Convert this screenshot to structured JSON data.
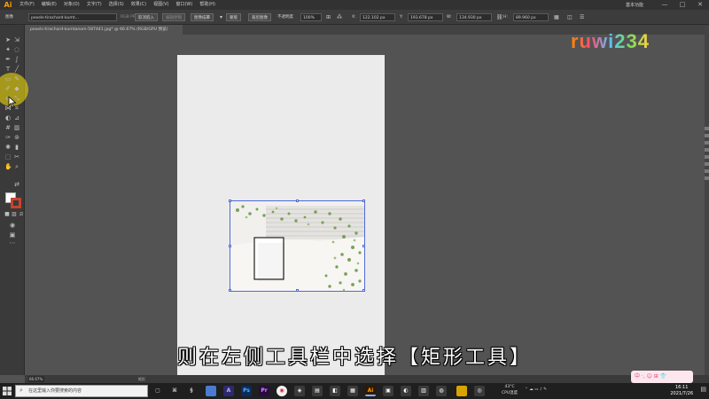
{
  "app": {
    "logo": "Ai"
  },
  "menu": {
    "items": [
      "文件(F)",
      "编辑(E)",
      "对象(O)",
      "文字(T)",
      "选择(S)",
      "效果(C)",
      "视图(V)",
      "窗口(W)",
      "帮助(H)"
    ],
    "workspace": "基本功能",
    "window_buttons": [
      "—",
      "□",
      "✕"
    ]
  },
  "control_bar": {
    "object_type": "图像",
    "file_name": "pexels-tirachard-kumt…",
    "color_info": "RGB PPI: 1120",
    "unembed": "取消嵌入",
    "edit_original": "编辑原稿",
    "image_trace": "图像描摹",
    "mask": "蒙版",
    "crop_image": "裁剪图像",
    "opacity_label": "不透明度",
    "opacity_value": "100%",
    "x_label": "X:",
    "x_value": "122.102 px",
    "y_label": "Y:",
    "y_value": "193.678 px",
    "w_label": "W:",
    "w_value": "134.930 px",
    "h_label": "H:",
    "h_value": "89.960 px"
  },
  "document_tab": {
    "title": "pexels-tirachard-kumtanom-587441.jpg* @ 66.67% (RGB/GPU 预览)"
  },
  "toolbar": {
    "icons": [
      "selection-tool",
      "direct-selection-tool",
      "magic-wand-tool",
      "pen-tool",
      "type-tool",
      "line-segment-tool",
      "rectangle-tool",
      "paintbrush-tool",
      "eraser-tool",
      "rotate-tool",
      "scale-tool",
      "width-tool",
      "free-transform-tool",
      "shape-builder-tool",
      "perspective-grid-tool",
      "mesh-tool",
      "gradient-tool",
      "eyedropper-tool",
      "blend-tool",
      "symbol-sprayer-tool",
      "column-graph-tool",
      "artboard-tool",
      "slice-tool",
      "hand-tool",
      "zoom-tool"
    ]
  },
  "canvas": {
    "subtitle": "则在左侧工具栏中选择【矩形工具】"
  },
  "watermark": {
    "text": "ruwi234"
  },
  "status_bar": {
    "zoom": "66.67%",
    "tool_name": "矩形"
  },
  "taskbar": {
    "search_placeholder": "在这里输入你要搜索的内容",
    "weather_temp": "43°C",
    "weather_label": "CPU温度",
    "time": "16:11",
    "date": "2021/7/26",
    "lang_badge": "中 ·, ☺ ⊞ 👕"
  },
  "colors": {
    "accent_ai": "#ff9a00",
    "selection": "#4f6bd7",
    "highlight": "#ffe600",
    "stroke_red": "#c7432f"
  }
}
